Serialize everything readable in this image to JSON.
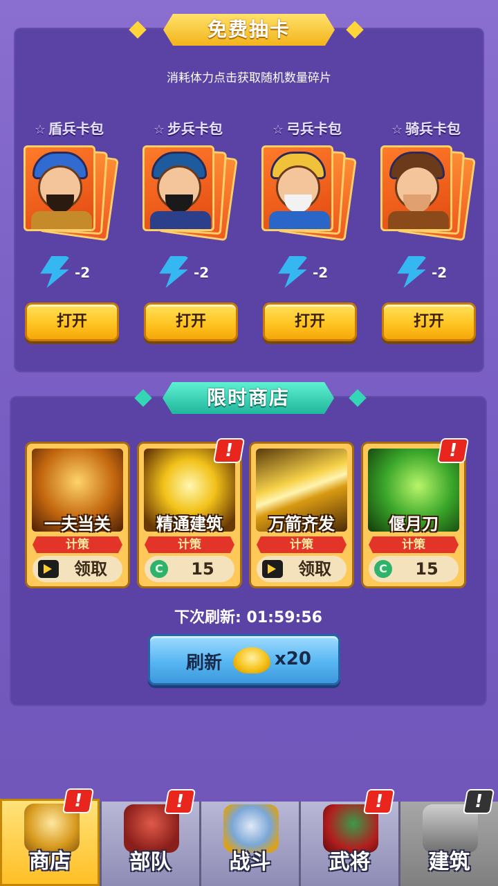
{
  "free_draw": {
    "title": "免费抽卡",
    "subtitle": "消耗体力点击获取随机数量碎片",
    "packs": [
      {
        "name": "盾兵卡包",
        "cost": "-2",
        "button": "打开"
      },
      {
        "name": "步兵卡包",
        "cost": "-2",
        "button": "打开"
      },
      {
        "name": "弓兵卡包",
        "cost": "-2",
        "button": "打开"
      },
      {
        "name": "骑兵卡包",
        "cost": "-2",
        "button": "打开"
      }
    ]
  },
  "limited_shop": {
    "title": "限时商店",
    "items": [
      {
        "name": "一夫当关",
        "type": "计策",
        "price": "领取",
        "price_icon": "video-icon",
        "alert": false
      },
      {
        "name": "精通建筑",
        "type": "计策",
        "price": "15",
        "price_icon": "coin-icon",
        "alert": true
      },
      {
        "name": "万箭齐发",
        "type": "计策",
        "price": "领取",
        "price_icon": "video-icon",
        "alert": false
      },
      {
        "name": "偃月刀",
        "type": "计策",
        "price": "15",
        "price_icon": "coin-icon",
        "alert": true
      }
    ],
    "refresh_timer_label": "下次刷新:",
    "refresh_timer_value": "01:59:56",
    "refresh_button": {
      "label": "刷新",
      "multiplier": "x20",
      "currency_icon": "gold-ingot-icon"
    }
  },
  "alert_mark": "!",
  "bottom_nav": [
    {
      "label": "商店",
      "active": true,
      "alert": true
    },
    {
      "label": "部队",
      "active": false,
      "alert": true
    },
    {
      "label": "战斗",
      "active": false,
      "alert": false
    },
    {
      "label": "武将",
      "active": false,
      "alert": true
    },
    {
      "label": "建筑",
      "active": false,
      "alert": true,
      "disabled": true
    }
  ],
  "colors": {
    "accent_gold": "#ffc21e",
    "accent_teal": "#20b79c",
    "panel": "#5b43a6",
    "alert_red": "#e8261e",
    "refresh_blue": "#57b6f2"
  }
}
